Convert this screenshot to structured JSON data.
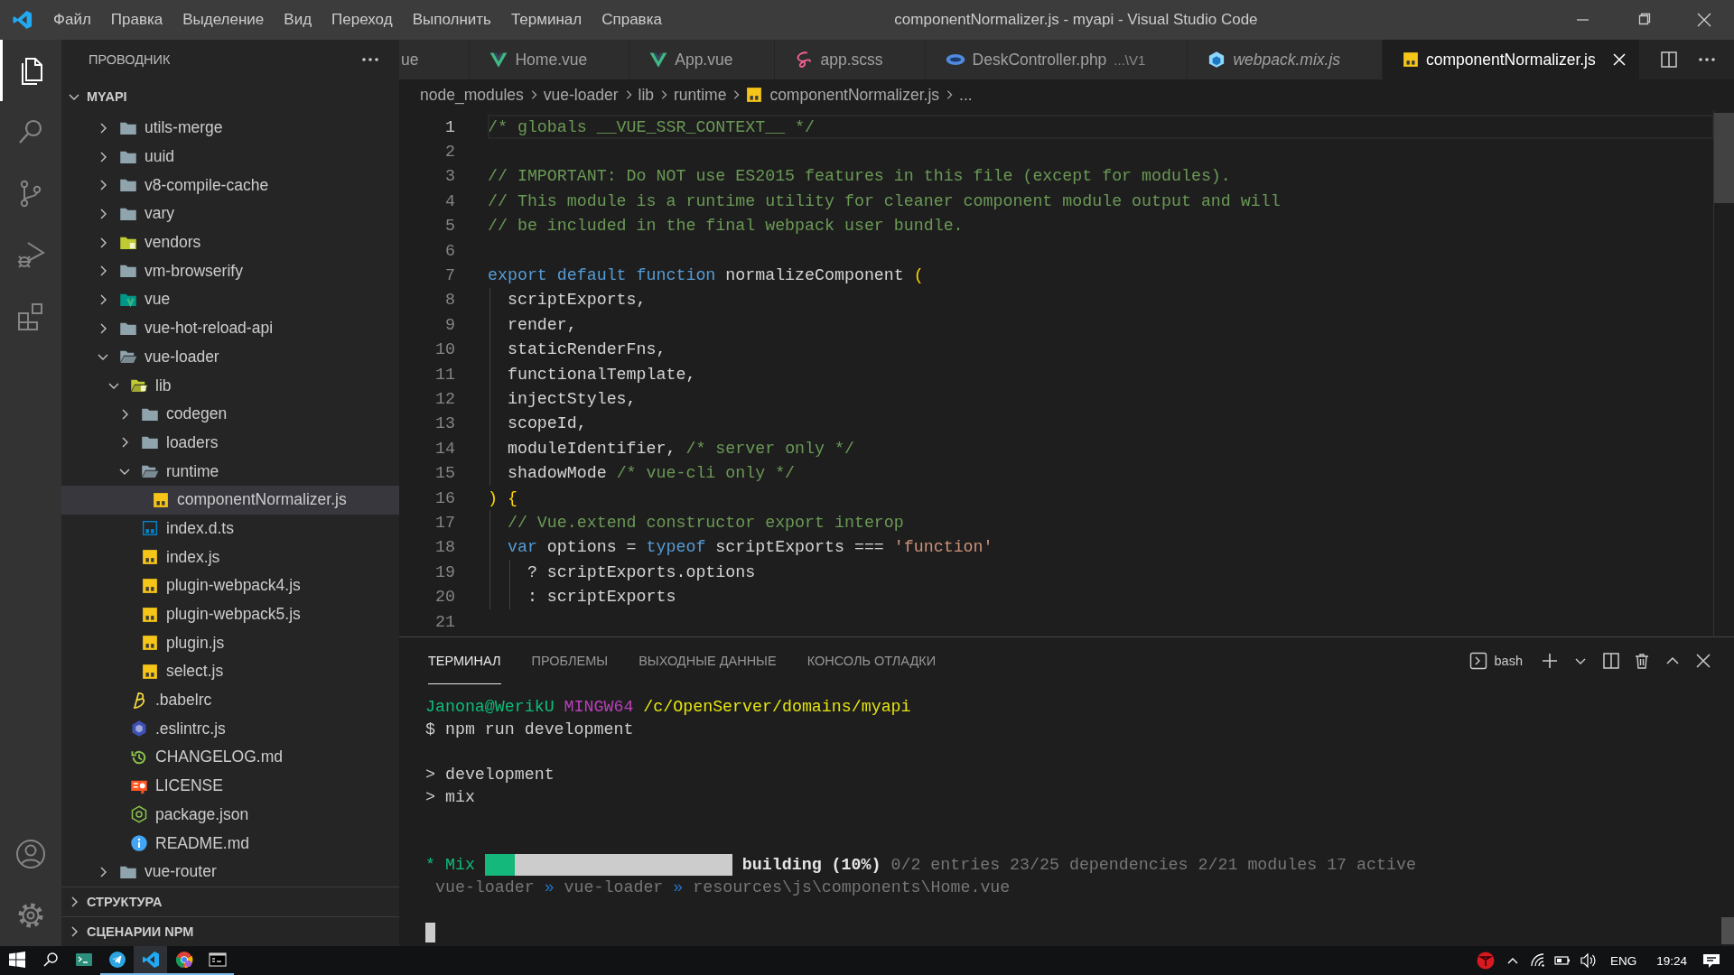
{
  "title_bar": {
    "menu": [
      "Файл",
      "Правка",
      "Выделение",
      "Вид",
      "Переход",
      "Выполнить",
      "Терминал",
      "Справка"
    ],
    "title": "componentNormalizer.js - myapi - Visual Studio Code"
  },
  "activity_bar": {
    "top": [
      {
        "selected": true
      },
      {
        "selected": false
      },
      {
        "selected": false
      },
      {
        "selected": false
      },
      {
        "selected": false
      }
    ],
    "bottom": [
      {
        "selected": false
      },
      {
        "selected": false
      }
    ]
  },
  "sidebar": {
    "title": "ПРОВОДНИК",
    "sections": [
      {
        "label": "MYAPI",
        "expanded": true,
        "tree": [
          {
            "name": "utils-merge",
            "kind": "folder",
            "expanded": false,
            "selected": false
          },
          {
            "name": "uuid",
            "kind": "folder",
            "expanded": false,
            "selected": false
          },
          {
            "name": "v8-compile-cache",
            "kind": "folder",
            "expanded": false,
            "selected": false
          },
          {
            "name": "vary",
            "kind": "folder",
            "expanded": false,
            "selected": false
          },
          {
            "name": "vendors",
            "kind": "vendors",
            "expanded": false,
            "selected": false
          },
          {
            "name": "vm-browserify",
            "kind": "folder",
            "expanded": false,
            "selected": false
          },
          {
            "name": "vue",
            "kind": "vue",
            "expanded": false,
            "selected": false
          },
          {
            "name": "vue-hot-reload-api",
            "kind": "folder",
            "expanded": false,
            "selected": false
          },
          {
            "name": "vue-loader",
            "kind": "folder",
            "expanded": true,
            "selected": false,
            "children": [
              {
                "name": "lib",
                "kind": "lib",
                "expanded": true,
                "selected": false,
                "children": [
                  {
                    "name": "codegen",
                    "kind": "folder",
                    "expanded": false,
                    "selected": false
                  },
                  {
                    "name": "loaders",
                    "kind": "folder",
                    "expanded": false,
                    "selected": false
                  },
                  {
                    "name": "runtime",
                    "kind": "folder",
                    "expanded": true,
                    "selected": false,
                    "children": [
                      {
                        "name": "componentNormalizer.js",
                        "kind": "js",
                        "selected": true
                      }
                    ]
                  },
                  {
                    "name": "index.d.ts",
                    "kind": "ts",
                    "selected": false
                  },
                  {
                    "name": "index.js",
                    "kind": "js",
                    "selected": false
                  },
                  {
                    "name": "plugin-webpack4.js",
                    "kind": "js",
                    "selected": false
                  },
                  {
                    "name": "plugin-webpack5.js",
                    "kind": "js",
                    "selected": false
                  },
                  {
                    "name": "plugin.js",
                    "kind": "js",
                    "selected": false
                  },
                  {
                    "name": "select.js",
                    "kind": "js",
                    "selected": false
                  }
                ]
              },
              {
                "name": ".babelrc",
                "kind": "babel",
                "selected": false
              },
              {
                "name": ".eslintrc.js",
                "kind": "eslint",
                "selected": false
              },
              {
                "name": "CHANGELOG.md",
                "kind": "changelog",
                "selected": false
              },
              {
                "name": "LICENSE",
                "kind": "license",
                "selected": false
              },
              {
                "name": "package.json",
                "kind": "npm",
                "selected": false
              },
              {
                "name": "README.md",
                "kind": "readme",
                "selected": false
              }
            ]
          },
          {
            "name": "vue-router",
            "kind": "folder",
            "expanded": false,
            "selected": false
          }
        ]
      },
      {
        "label": "СТРУКТУРА",
        "expanded": false
      },
      {
        "label": "СЦЕНАРИИ NPM",
        "expanded": false
      }
    ]
  },
  "tabs": [
    {
      "label": "ue",
      "kind": "cut",
      "selected": false,
      "preview": false
    },
    {
      "label": "Home.vue",
      "kind": "vue",
      "selected": false,
      "preview": false
    },
    {
      "label": "App.vue",
      "kind": "vue",
      "selected": false,
      "preview": false
    },
    {
      "label": "app.scss",
      "kind": "sass",
      "selected": false,
      "preview": false
    },
    {
      "label": "DeskController.php",
      "kind": "php",
      "selected": false,
      "preview": false,
      "description": "...\\V1"
    },
    {
      "label": "webpack.mix.js",
      "kind": "webpack",
      "selected": false,
      "preview": true
    },
    {
      "label": "componentNormalizer.js",
      "kind": "js",
      "selected": true,
      "preview": false
    }
  ],
  "breadcrumbs": [
    {
      "label": "node_modules",
      "kind": "folder"
    },
    {
      "label": "vue-loader",
      "kind": "folder"
    },
    {
      "label": "lib",
      "kind": "folder"
    },
    {
      "label": "runtime",
      "kind": "folder"
    },
    {
      "label": "componentNormalizer.js",
      "kind": "js"
    },
    {
      "label": "...",
      "kind": "more"
    }
  ],
  "editor": {
    "lines": [
      {
        "number": "1",
        "current": true,
        "tokens": [
          {
            "text": "/* globals __VUE_SSR_CONTEXT__ */",
            "kind": "comment"
          }
        ]
      },
      {
        "number": "2",
        "current": false
      },
      {
        "number": "3",
        "current": false,
        "tokens": [
          {
            "text": "// IMPORTANT: Do NOT use ES2015 features in this file (except for modules).",
            "kind": "comment"
          }
        ]
      },
      {
        "number": "4",
        "current": false,
        "tokens": [
          {
            "text": "// This module is a runtime utility for cleaner component module output and will",
            "kind": "comment"
          }
        ]
      },
      {
        "number": "5",
        "current": false,
        "tokens": [
          {
            "text": "// be included in the final webpack user bundle.",
            "kind": "comment"
          }
        ]
      },
      {
        "number": "6",
        "current": false
      },
      {
        "number": "7",
        "current": false,
        "tokens": [
          {
            "text": "export default function",
            "kind": "keyword"
          },
          {
            "text": " normalizeComponent ",
            "kind": "plain"
          },
          {
            "text": "(",
            "kind": "bracket"
          }
        ]
      },
      {
        "number": "8",
        "current": false,
        "tokens": [
          {
            "text": "  scriptExports,",
            "kind": "plain"
          }
        ]
      },
      {
        "number": "9",
        "current": false,
        "tokens": [
          {
            "text": "  render,",
            "kind": "plain"
          }
        ]
      },
      {
        "number": "10",
        "current": false,
        "tokens": [
          {
            "text": "  staticRenderFns,",
            "kind": "plain"
          }
        ]
      },
      {
        "number": "11",
        "current": false,
        "tokens": [
          {
            "text": "  functionalTemplate,",
            "kind": "plain"
          }
        ]
      },
      {
        "number": "12",
        "current": false,
        "tokens": [
          {
            "text": "  injectStyles,",
            "kind": "plain"
          }
        ]
      },
      {
        "number": "13",
        "current": false,
        "tokens": [
          {
            "text": "  scopeId,",
            "kind": "plain"
          }
        ]
      },
      {
        "number": "14",
        "current": false,
        "tokens": [
          {
            "text": "  moduleIdentifier, ",
            "kind": "plain"
          },
          {
            "text": "/* server only */",
            "kind": "comment"
          }
        ]
      },
      {
        "number": "15",
        "current": false,
        "tokens": [
          {
            "text": "  shadowMode ",
            "kind": "plain"
          },
          {
            "text": "/* vue-cli only */",
            "kind": "comment"
          }
        ]
      },
      {
        "number": "16",
        "current": false,
        "tokens": [
          {
            "text": ") {",
            "kind": "bracket"
          }
        ]
      },
      {
        "number": "17",
        "current": false,
        "tokens": [
          {
            "text": "  // Vue.extend constructor export interop",
            "kind": "comment"
          }
        ]
      },
      {
        "number": "18",
        "current": false,
        "tokens": [
          {
            "text": "  var",
            "kind": "keyword"
          },
          {
            "text": " options = ",
            "kind": "plain"
          },
          {
            "text": "typeof",
            "kind": "keyword"
          },
          {
            "text": " scriptExports === ",
            "kind": "plain"
          },
          {
            "text": "'function'",
            "kind": "string"
          }
        ]
      },
      {
        "number": "19",
        "current": false,
        "tokens": [
          {
            "text": "    ? scriptExports.options",
            "kind": "plain"
          }
        ]
      },
      {
        "number": "20",
        "current": false,
        "tokens": [
          {
            "text": "    : scriptExports",
            "kind": "plain"
          }
        ]
      },
      {
        "number": "21",
        "current": false
      }
    ]
  },
  "panel": {
    "tabs": [
      {
        "label": "ТЕРМИНАЛ",
        "selected": true
      },
      {
        "label": "ПРОБЛЕМЫ",
        "selected": false
      },
      {
        "label": "ВЫХОДНЫЕ ДАННЫЕ",
        "selected": false
      },
      {
        "label": "КОНСОЛЬ ОТЛАДКИ",
        "selected": false
      }
    ],
    "shell": "bash",
    "terminal": [
      {
        "kind": "text",
        "segments": [
          {
            "text": "Janona@WerikU ",
            "kind": "user"
          },
          {
            "text": "MINGW64 ",
            "kind": "host"
          },
          {
            "text": "/c/OpenServer/domains/myapi",
            "kind": "path"
          }
        ]
      },
      {
        "kind": "text",
        "segments": [
          {
            "text": "$ npm run development",
            "kind": "plain"
          }
        ]
      },
      {
        "kind": "blank"
      },
      {
        "kind": "text",
        "segments": [
          {
            "text": "> development",
            "kind": "plain"
          }
        ]
      },
      {
        "kind": "text",
        "segments": [
          {
            "text": "> mix",
            "kind": "plain"
          }
        ]
      },
      {
        "kind": "blank"
      },
      {
        "kind": "blank"
      },
      {
        "kind": "progress",
        "label": "* Mix",
        "level": 0.12,
        "status": "building (10%)",
        "detail": "0/2 entries 23/25 dependencies 2/21 modules 17 active"
      },
      {
        "kind": "text",
        "segments": [
          {
            "text": " vue-loader ",
            "kind": "dim"
          },
          {
            "text": "»",
            "kind": "sep"
          },
          {
            "text": " vue-loader ",
            "kind": "dim"
          },
          {
            "text": "»",
            "kind": "sep"
          },
          {
            "text": " resources\\js\\components\\Home.vue",
            "kind": "dim"
          }
        ]
      },
      {
        "kind": "blank"
      },
      {
        "kind": "cursor"
      }
    ]
  },
  "taskbar": {
    "apps": [
      {
        "kind": "terminal",
        "running": false,
        "active": false
      },
      {
        "kind": "telegram",
        "running": true,
        "active": false
      },
      {
        "kind": "code",
        "running": true,
        "active": true
      },
      {
        "kind": "browser",
        "running": true,
        "active": false
      },
      {
        "kind": "console",
        "running": true,
        "active": false
      }
    ],
    "language": "ENG",
    "time": "19:24"
  }
}
